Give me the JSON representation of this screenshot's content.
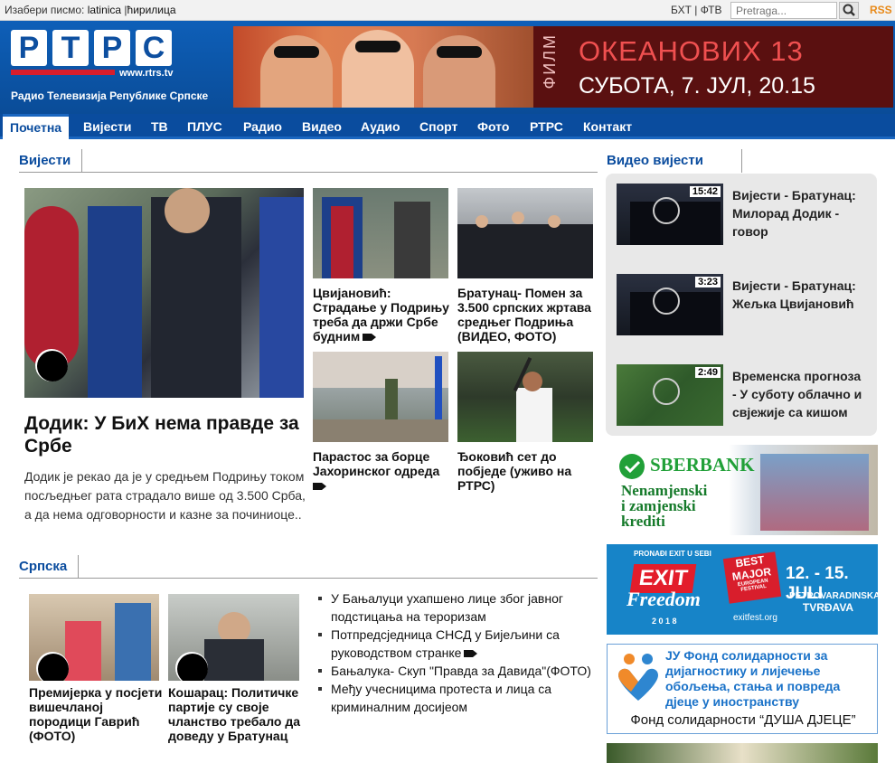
{
  "topbar": {
    "lang_label": "Изабери писмо:",
    "lat": "latinica",
    "cyr": "ћирилица",
    "scripts": "БХТ | ФТВ",
    "search_placeholder": "Pretraga...",
    "rss": "RSS"
  },
  "header": {
    "logo_letters": [
      "Р",
      "Т",
      "Р",
      "С"
    ],
    "logo_url": "www.rtrs.tv",
    "tagline": "Радио Телевизија Републике Српске",
    "banner": {
      "vertical": "ФИЛМ",
      "title": "ОКЕАНОВИХ 13",
      "subtitle": "СУБОТА, 7. ЈУЛ, 20.15"
    }
  },
  "nav": [
    "Почетна",
    "Вијести",
    "ТВ",
    "ПЛУС",
    "Радио",
    "Видео",
    "Аудио",
    "Спорт",
    "Фото",
    "РТРС",
    "Контакт"
  ],
  "news": {
    "heading": "Вијести",
    "main_title": "Додик: У БиХ нема правде за Србе",
    "main_text": "Додик је рекао да је у средњем Подрињу током посљедњег рата страдало више од 3.500 Срба, а да нема одговорности и казне за починиоце..",
    "items": [
      "Цвијановић: Страдање у Подрињу треба да држи Србе будним",
      "Братунац- Помен за 3.500 српских жртава средњег Подриња (ВИДЕО, ФОТО)",
      "Парастос за борце Јахоринског одреда",
      "Ђоковић сет до побједе (уживо на РТРС)"
    ]
  },
  "video": {
    "heading": "Видео вијести",
    "items": [
      {
        "dur": "15:42",
        "title": "Вијести - Братунац: Милорад Додик - говор"
      },
      {
        "dur": "3:23",
        "title": "Вијести - Братунац: Жељка Цвијановић"
      },
      {
        "dur": "2:49",
        "title": "Временска прогноза - У суботу облачно и свјежије са кишом"
      }
    ]
  },
  "srpska": {
    "heading": "Српска",
    "items": [
      "Премијерка у посјети вишечланој породици Гаврић (ФОТО)",
      "Кошарац: Политичке партије су своје чланство требало да доведу у Братунац"
    ],
    "bullets": [
      "У Бањалуци ухапшено лице због јавног подстицања на тероризам",
      "Потпредсједница СНСД у Бијељини са руководством странке",
      "Бањалука- Скуп \"Правда за Давида\"(ФОТО)",
      "Међу учесницима протеста и лица са криминалним досијеом"
    ]
  },
  "ads": {
    "sber": {
      "brand": "SBERBANK",
      "l1": "Nenamjenski",
      "l2": "i zamjenski",
      "l3": "krediti"
    },
    "exit": {
      "top": "PRONAĐI EXIT U SEBI",
      "logo": "EXIT",
      "word": "Freedom",
      "year": "2 0 1 8",
      "badge1": "BEST",
      "badge2": "MAJOR",
      "badge3": "EUROPEAN FESTIVAL",
      "dates": "12. - 15. JULI",
      "place1": "PETROVARADINSKA",
      "place2": "TVRĐAVA",
      "url": "exitfest.org"
    },
    "fond": {
      "l1": "ЈУ Фонд солидарности за",
      "l2": "дијагностику и лијечење",
      "l3": "обољења, стања и повреда",
      "l4": "дјеце у иностранству",
      "foot": "Фонд солидарности “ДУША ДЈЕЦЕ”"
    }
  },
  "colors": {
    "brand": "#0a4c9e",
    "red": "#d81e2c",
    "rss": "#e88a1a"
  }
}
